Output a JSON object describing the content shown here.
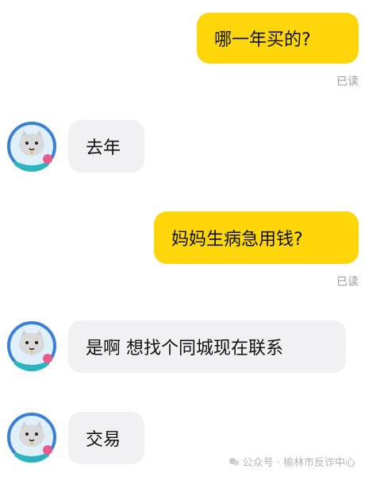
{
  "chat": {
    "messages": [
      {
        "side": "me",
        "text": "哪一年买的?",
        "status": "已读"
      },
      {
        "side": "them",
        "text": "去年"
      },
      {
        "side": "me",
        "text": "妈妈生病急用钱?",
        "status": "已读"
      },
      {
        "side": "them",
        "text": "是啊 想找个同城现在联系"
      },
      {
        "side": "them",
        "text": "交易"
      }
    ]
  },
  "watermark": {
    "text": "公众号 · 榆林市反诈中心"
  },
  "avatar": {
    "icon": "cat-astronaut-icon",
    "ring_color": "#3b7fd6",
    "bg_color": "#dff0fb"
  }
}
